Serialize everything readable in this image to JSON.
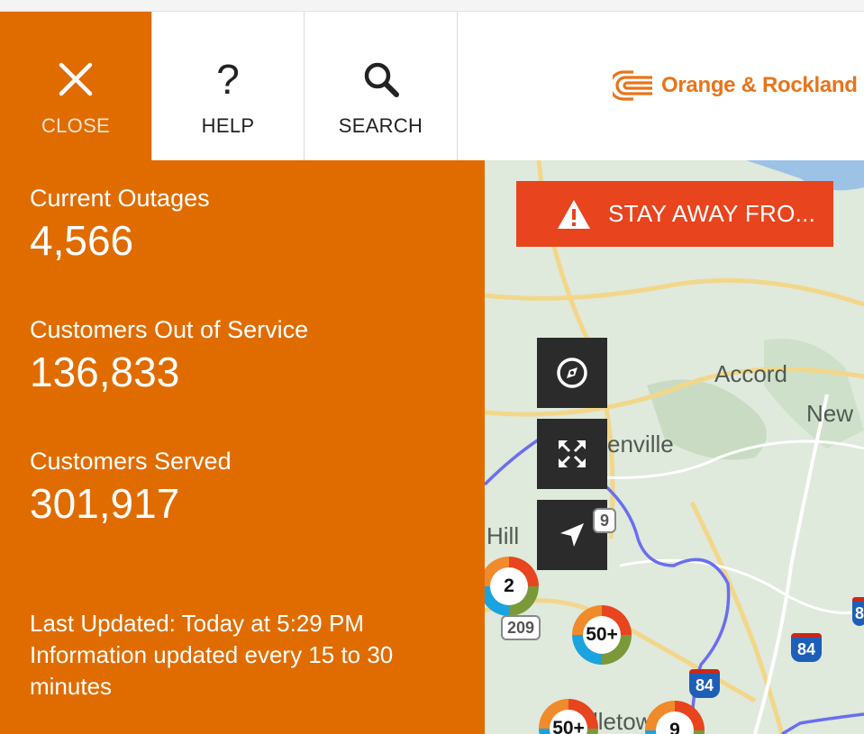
{
  "toolbar": {
    "close_label": "CLOSE",
    "help_label": "HELP",
    "help_glyph": "?",
    "search_label": "SEARCH",
    "close_icon": "close-icon",
    "search_icon": "search-icon"
  },
  "logo": {
    "text": "Orange & Rockland"
  },
  "stats": {
    "current_outages_label": "Current Outages",
    "current_outages_value": "4,566",
    "customers_out_label": "Customers Out of Service",
    "customers_out_value": "136,833",
    "customers_served_label": "Customers Served",
    "customers_served_value": "301,917",
    "last_updated": "Last Updated: Today at 5:29 PM",
    "update_frequency": "Information updated every 15 to 30 minutes"
  },
  "map": {
    "alert_text": "STAY AWAY FRO...",
    "places": {
      "accord": "Accord",
      "new": "New",
      "enville": "enville",
      "hill": "Hill",
      "lleto": "lletow"
    },
    "clusters": [
      "2",
      "50+",
      "50+",
      "9"
    ],
    "shields": {
      "us209": "209",
      "i84_a": "84",
      "i84_b": "84",
      "route_9": "9",
      "route_8": "8"
    },
    "controls": [
      "compass-icon",
      "fullscreen-icon",
      "locate-icon"
    ]
  },
  "colors": {
    "brand_orange": "#e06c00",
    "alert_red": "#e8441e",
    "map_green": "#dfe9dc",
    "boundary_blue": "#6a6ef0"
  }
}
